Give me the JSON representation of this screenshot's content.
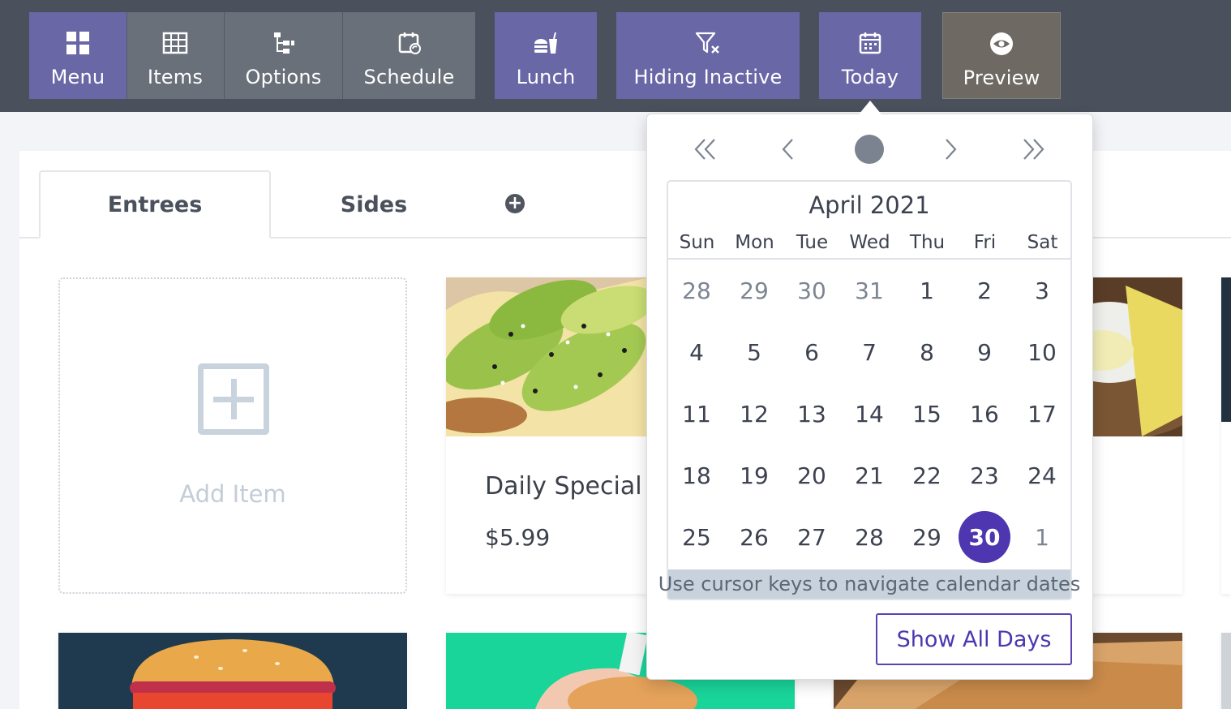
{
  "toolbar": {
    "menu": "Menu",
    "items": "Items",
    "options": "Options",
    "schedule": "Schedule",
    "meal": "Lunch",
    "filter": "Hiding Inactive",
    "date": "Today",
    "preview": "Preview",
    "icons": [
      "grid-icon",
      "table-icon",
      "tree-icon",
      "calendar-sync-icon",
      "food-drink-icon",
      "filter-x-icon",
      "calendar-icon",
      "eye-icon"
    ],
    "colors": {
      "bar": "#4b515c",
      "gray_group": "#6a7079",
      "purple": "#6a67a6",
      "preview": "#6e6a63"
    }
  },
  "tabs": [
    {
      "label": "Entrees",
      "active": true
    },
    {
      "label": "Sides",
      "active": false
    }
  ],
  "add_item": {
    "label": "Add Item"
  },
  "items": [
    {
      "name": "Daily Special 1",
      "price": "$5.99"
    }
  ],
  "calendar": {
    "title": "April 2021",
    "weekdays": [
      "Sun",
      "Mon",
      "Tue",
      "Wed",
      "Thu",
      "Fri",
      "Sat"
    ],
    "weeks": [
      [
        "28",
        "29",
        "30",
        "31",
        "1",
        "2",
        "3"
      ],
      [
        "4",
        "5",
        "6",
        "7",
        "8",
        "9",
        "10"
      ],
      [
        "11",
        "12",
        "13",
        "14",
        "15",
        "16",
        "17"
      ],
      [
        "18",
        "19",
        "20",
        "21",
        "22",
        "23",
        "24"
      ],
      [
        "25",
        "26",
        "27",
        "28",
        "29",
        "30",
        "1"
      ]
    ],
    "selected": "30",
    "hint": "Use cursor keys to navigate calendar dates",
    "show_all": "Show All Days",
    "accent": "#4d36b0"
  }
}
